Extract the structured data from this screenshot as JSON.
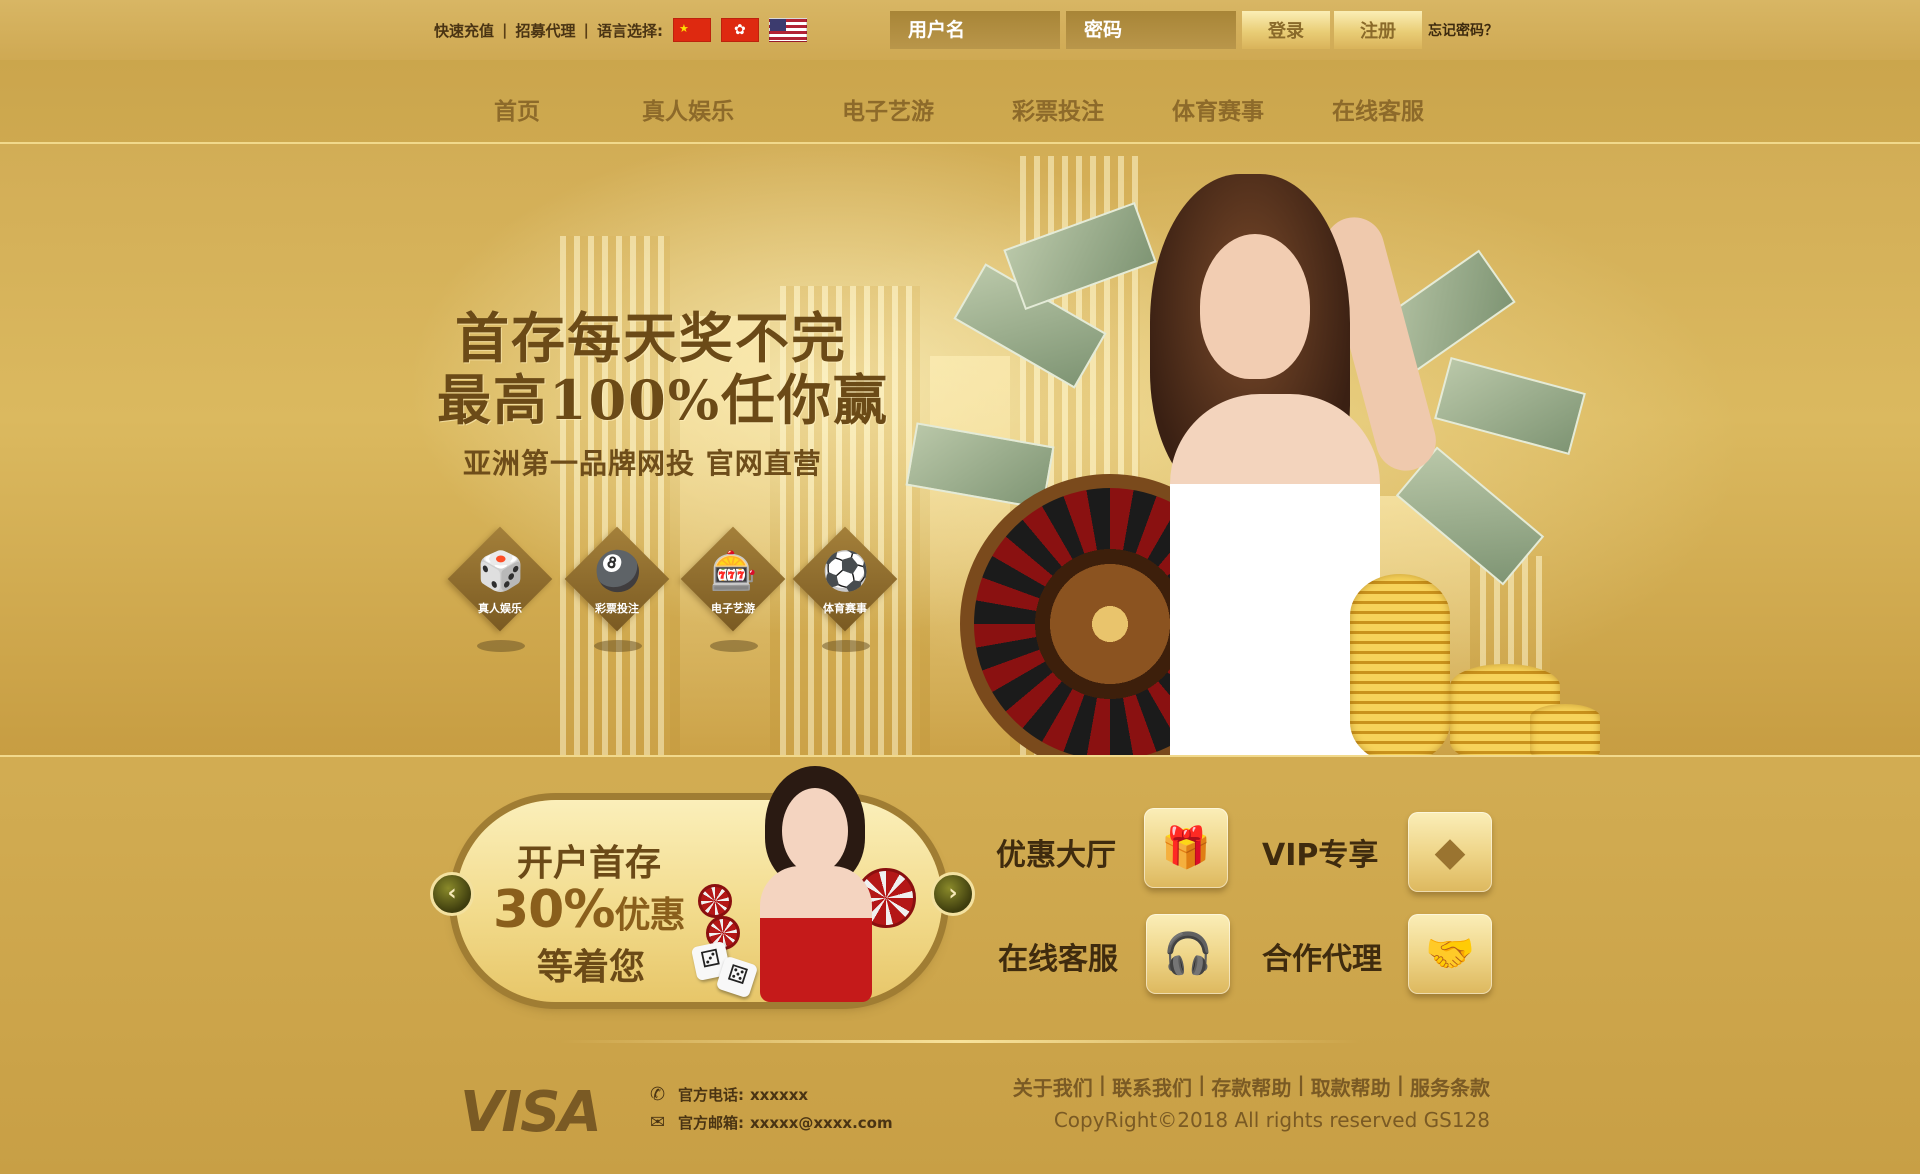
{
  "topbar": {
    "quick_deposit": "快速充值",
    "recruit_agent": "招募代理",
    "language_label": "语言选择:",
    "flags": [
      "cn-flag",
      "hk-flag",
      "us-flag"
    ],
    "username_placeholder": "用户名",
    "password_placeholder": "密码",
    "login_label": "登录",
    "register_label": "注册",
    "forgot_label": "忘记密码？"
  },
  "nav": {
    "items": [
      "首页",
      "真人娱乐",
      "电子艺游",
      "彩票投注",
      "体育赛事",
      "在线客服"
    ]
  },
  "banner": {
    "line1": "首存每天奖不完",
    "line2": "最高100%任你赢",
    "line3": "亚洲第一品牌网投  官网直营",
    "categories": [
      {
        "label": "真人娱乐",
        "icon": "dice-icon"
      },
      {
        "label": "彩票投注",
        "icon": "lottery-ball-icon"
      },
      {
        "label": "电子艺游",
        "icon": "slot-machine-icon"
      },
      {
        "label": "体育赛事",
        "icon": "soccer-ball-icon"
      }
    ]
  },
  "promo": {
    "line1": "开户首存",
    "percent": "30%",
    "discount": "优惠",
    "line3": "等着您"
  },
  "quick_links": [
    {
      "label": "优惠大厅",
      "icon": "gift-icon"
    },
    {
      "label": "VIP专享",
      "icon": "diamond-icon"
    },
    {
      "label": "在线客服",
      "icon": "headset-icon"
    },
    {
      "label": "合作代理",
      "icon": "handshake-icon"
    }
  ],
  "footer": {
    "visa": "VISA",
    "phone_label": "官方电话:",
    "phone_value": "xxxxxx",
    "email_label": "官方邮箱:",
    "email_value": "xxxxx@xxxx.com",
    "links": [
      "关于我们",
      "联系我们",
      "存款帮助",
      "取款帮助",
      "服务条款"
    ],
    "copyright": "CopyRight©2018 All rights reserved GS128"
  },
  "colors": {
    "gold_bg": "#d2ad56",
    "dark_brown": "#4a3413",
    "nav_text": "#8d6a2a"
  }
}
